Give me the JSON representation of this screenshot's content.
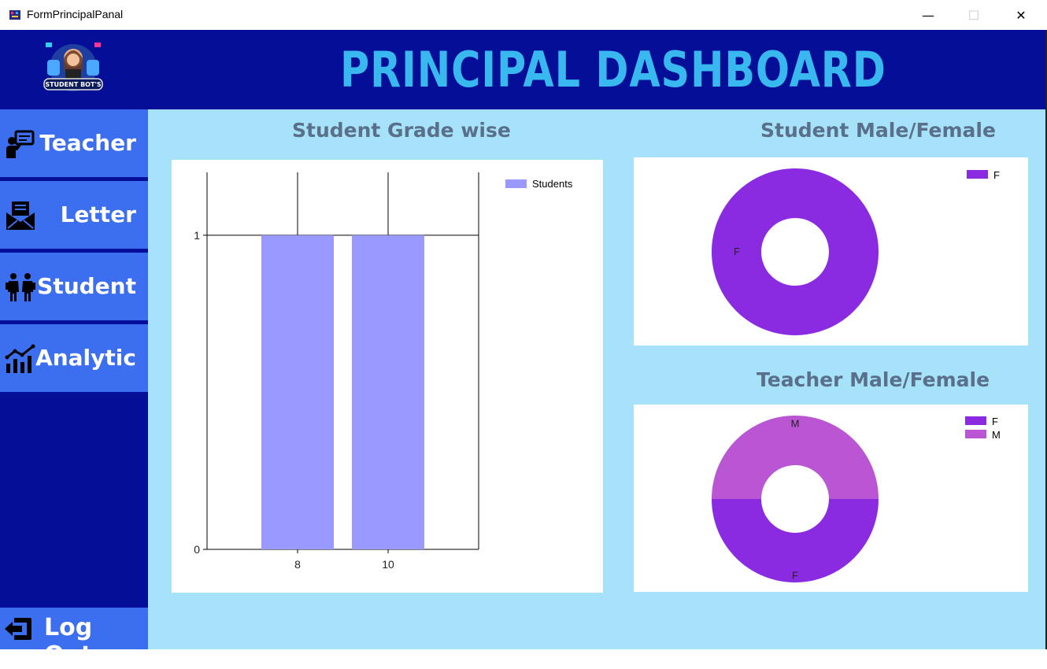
{
  "window": {
    "title": "FormPrincipalPanal",
    "minimize_glyph": "—",
    "maximize_glyph": "☐",
    "close_glyph": "✕"
  },
  "header": {
    "title": "PRINCIPAL DASHBOARD",
    "logo_text": "STUDENT BOT'S"
  },
  "sidebar": {
    "items": [
      {
        "label": "Teacher",
        "icon": "teacher-icon"
      },
      {
        "label": "Letter",
        "icon": "letter-icon"
      },
      {
        "label": "Student",
        "icon": "student-icon"
      },
      {
        "label": "Analytic",
        "icon": "analytic-icon"
      }
    ],
    "logout": {
      "label": "Log Out",
      "icon": "logout-icon"
    }
  },
  "colors": {
    "header_bg": "#040e97",
    "title_color": "#38b8ef",
    "nav_button": "#3c6ef0",
    "main_bg": "#a6e3fb",
    "bar_color": "#9999ff",
    "female_color": "#8a2be2",
    "male_color": "#ba55d3"
  },
  "sections": {
    "grade_title": "Student Grade wise",
    "student_gender_title": "Student Male/Female",
    "teacher_gender_title": "Teacher Male/Female"
  },
  "chart_data": [
    {
      "type": "bar",
      "categories": [
        "8",
        "10"
      ],
      "series": [
        {
          "name": "Students",
          "values": [
            1,
            1
          ]
        }
      ],
      "yticks": [
        "0",
        "1"
      ],
      "ylim": [
        0,
        1.2
      ],
      "legend": "top-right",
      "grid": true
    },
    {
      "type": "pie",
      "style": "doughnut",
      "labels": [
        "F"
      ],
      "values": [
        1
      ],
      "legend": "top-right"
    },
    {
      "type": "pie",
      "style": "doughnut",
      "labels": [
        "F",
        "M"
      ],
      "values": [
        1,
        1
      ],
      "legend": "top-right"
    }
  ]
}
